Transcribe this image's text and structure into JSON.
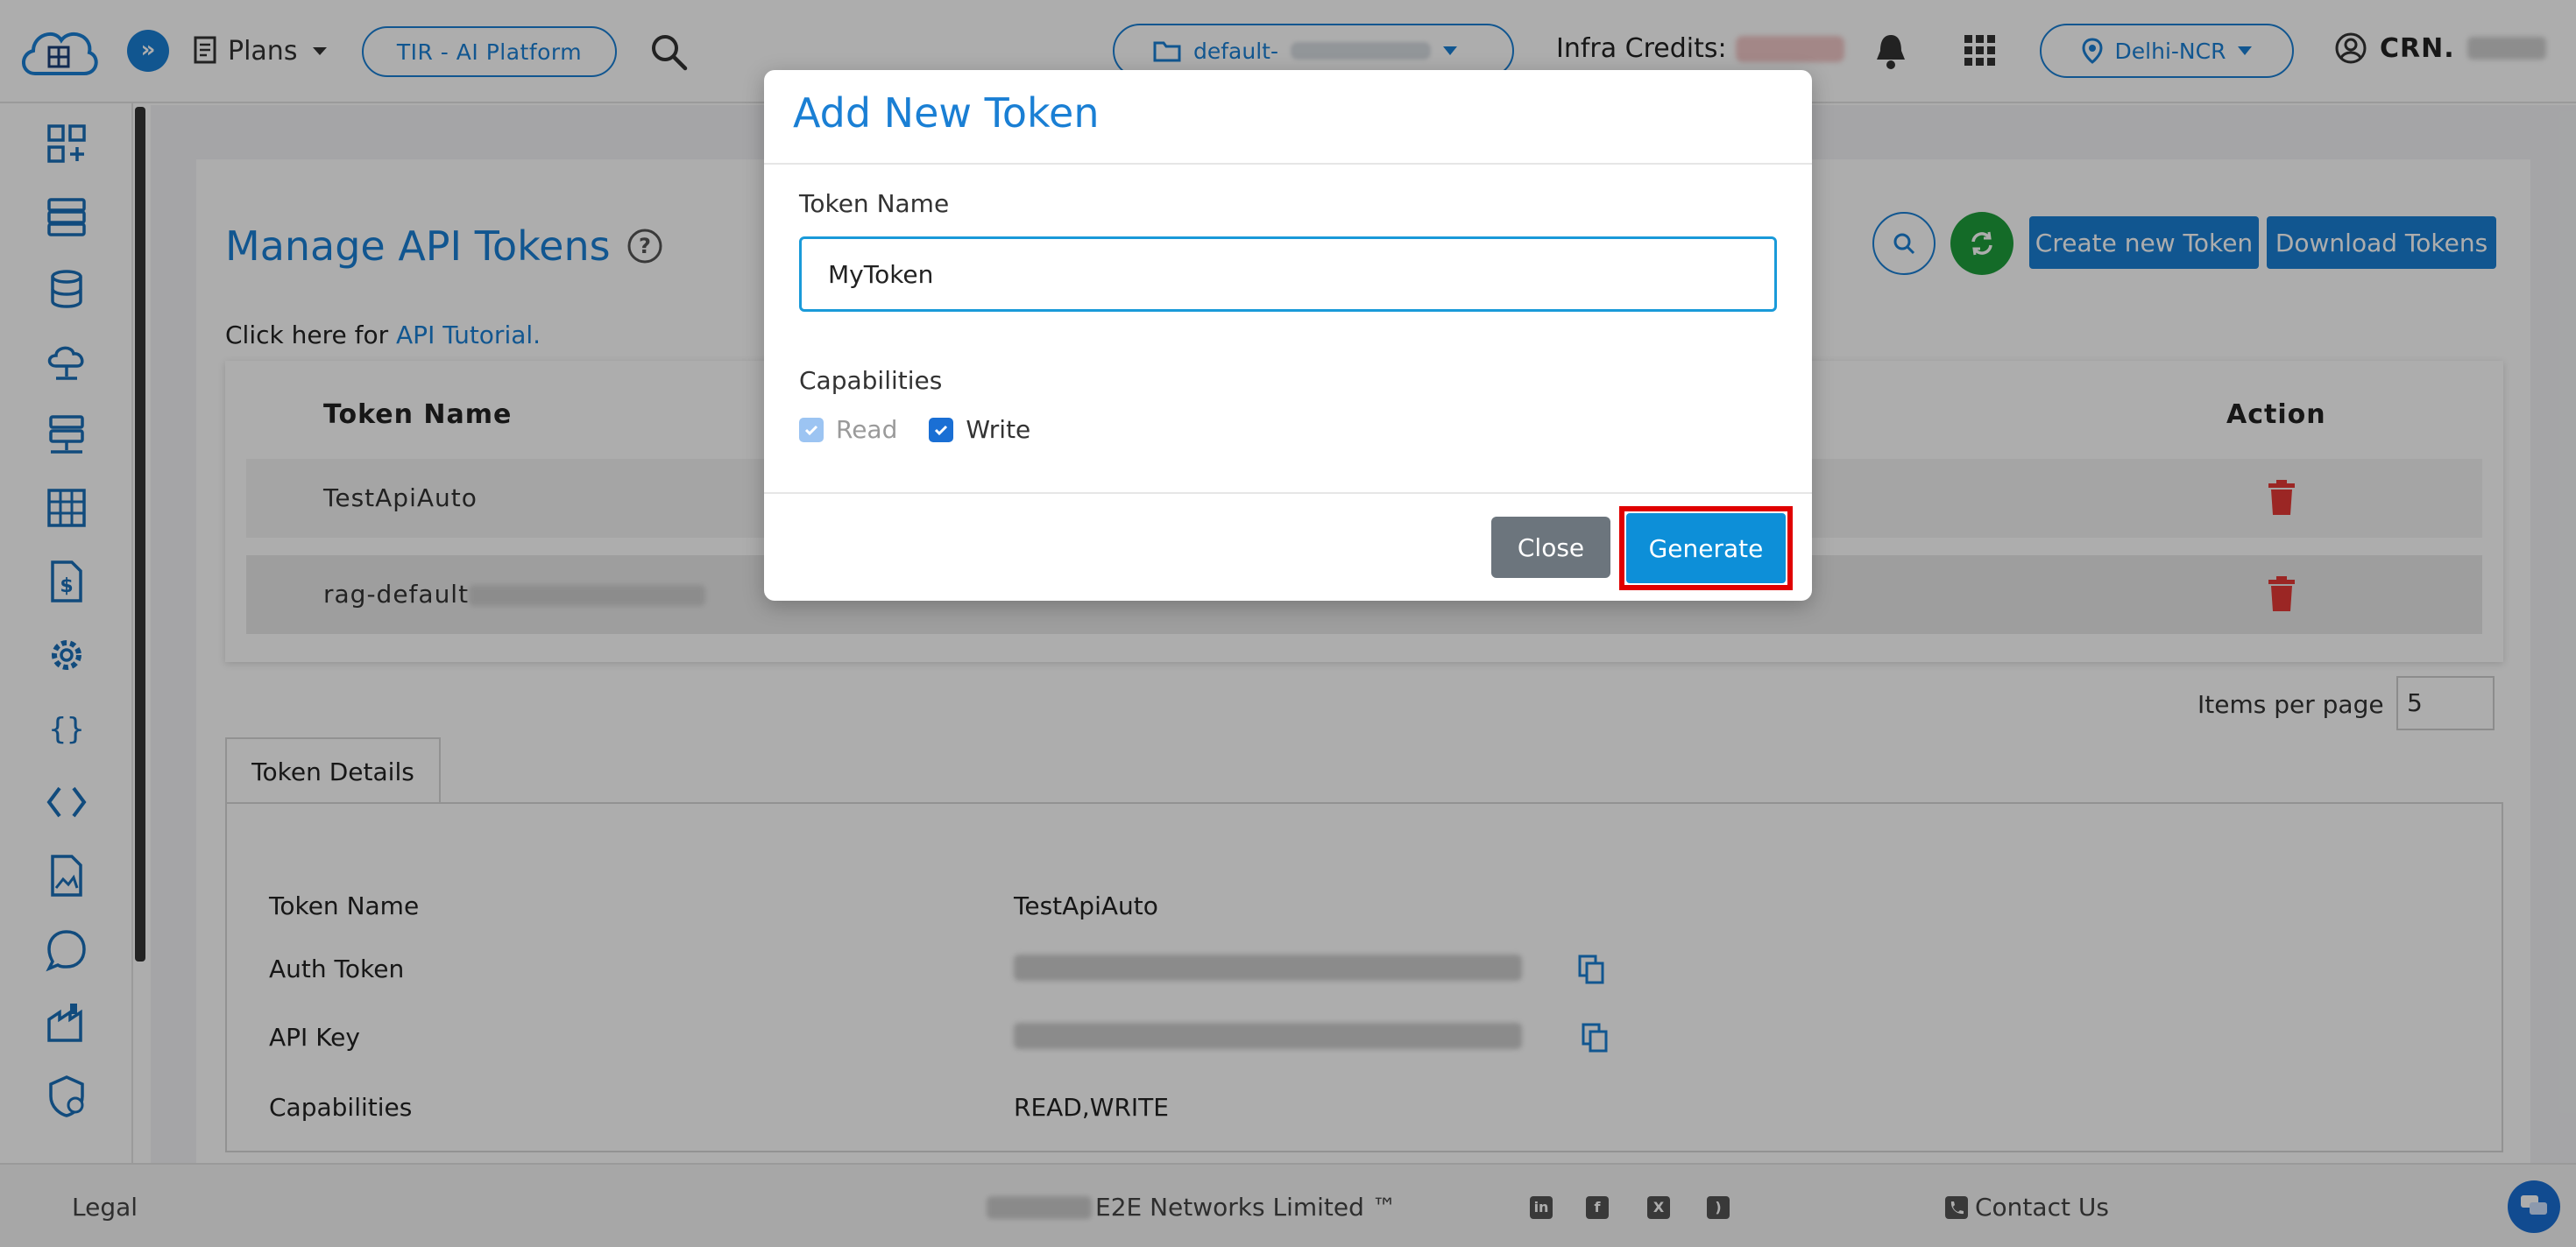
{
  "header": {
    "plans_label": "Plans",
    "platform_label": "TIR - AI Platform",
    "project_label": "default-",
    "credits_label": "Infra Credits:",
    "region_label": "Delhi-NCR",
    "user_label": "CRN."
  },
  "page": {
    "title": "Manage API Tokens",
    "tutorial_prefix": "Click here for",
    "tutorial_link": "API Tutorial.",
    "create_button": "Create new Token",
    "download_button": "Download Tokens"
  },
  "table": {
    "col_name": "Token Name",
    "col_action": "Action",
    "rows": [
      {
        "name": "TestApiAuto"
      },
      {
        "name": "rag-default"
      }
    ]
  },
  "pagination": {
    "items_per_page_label": "Items per page",
    "items_per_page_value": "5"
  },
  "details": {
    "tab_label": "Token Details",
    "token_name_label": "Token Name",
    "token_name_value": "TestApiAuto",
    "auth_token_label": "Auth Token",
    "api_key_label": "API Key",
    "capabilities_label": "Capabilities",
    "capabilities_value": "READ,WRITE"
  },
  "footer": {
    "legal": "Legal",
    "copyright": "E2E Networks Limited ™",
    "contact": "Contact Us"
  },
  "modal": {
    "title": "Add New Token",
    "token_name_label": "Token Name",
    "token_name_value": "MyToken",
    "capabilities_label": "Capabilities",
    "read_label": "Read",
    "write_label": "Write",
    "close_button": "Close",
    "generate_button": "Generate"
  },
  "colors": {
    "accent": "#1a7fd4",
    "refresh_green": "#1e9e3c",
    "delete_red": "#e53935",
    "highlight_red": "#e00000"
  }
}
